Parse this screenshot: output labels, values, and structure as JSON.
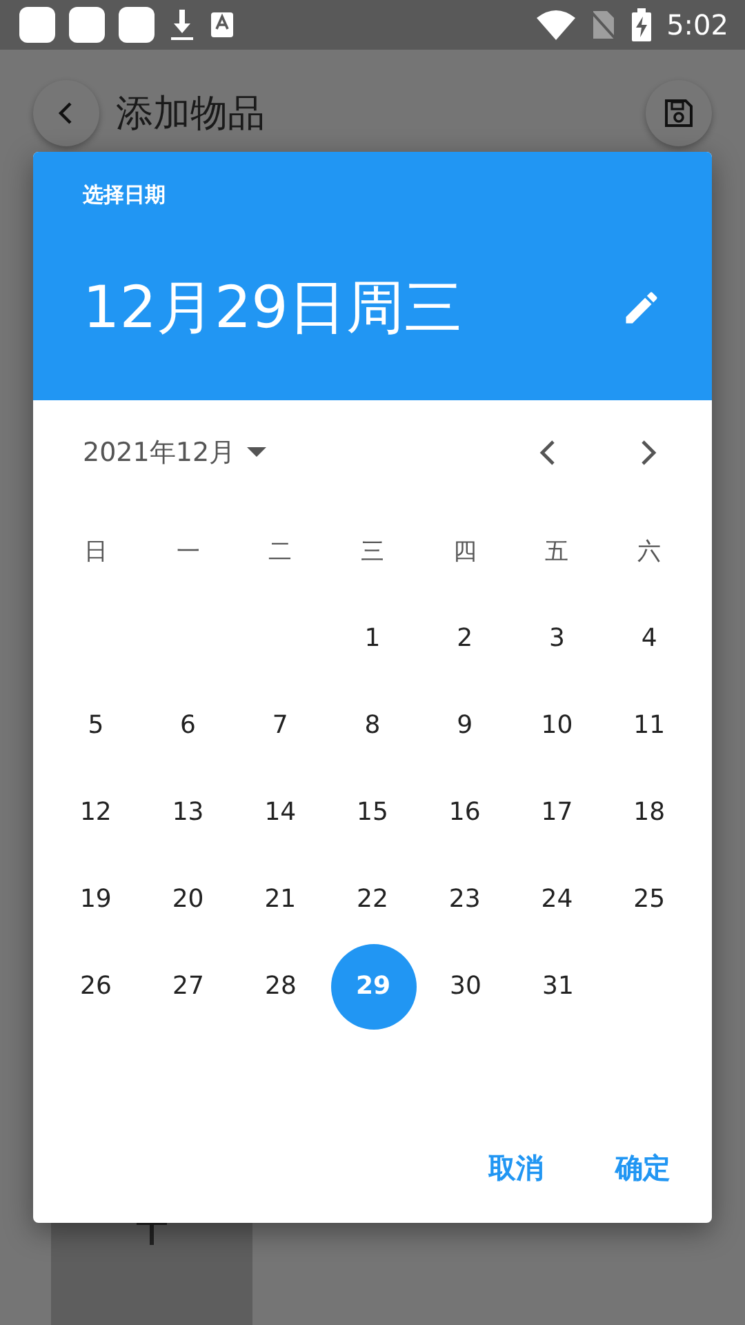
{
  "status_bar": {
    "time": "5:02"
  },
  "app_bar": {
    "title": "添加物品"
  },
  "dialog": {
    "header_label": "选择日期",
    "selected_date_text": "12月29日周三",
    "month_label": "2021年12月",
    "weekdays": [
      "日",
      "一",
      "二",
      "三",
      "四",
      "五",
      "六"
    ],
    "weeks": [
      {
        "days": [
          {
            "kind": "blank"
          },
          {
            "kind": "blank"
          },
          {
            "kind": "blank"
          },
          {
            "kind": "day",
            "label": "1",
            "selected": false
          },
          {
            "kind": "day",
            "label": "2",
            "selected": false
          },
          {
            "kind": "day",
            "label": "3",
            "selected": false
          },
          {
            "kind": "day",
            "label": "4",
            "selected": false
          }
        ]
      },
      {
        "days": [
          {
            "kind": "day",
            "label": "5",
            "selected": false
          },
          {
            "kind": "day",
            "label": "6",
            "selected": false
          },
          {
            "kind": "day",
            "label": "7",
            "selected": false
          },
          {
            "kind": "day",
            "label": "8",
            "selected": false
          },
          {
            "kind": "day",
            "label": "9",
            "selected": false
          },
          {
            "kind": "day",
            "label": "10",
            "selected": false
          },
          {
            "kind": "day",
            "label": "11",
            "selected": false
          }
        ]
      },
      {
        "days": [
          {
            "kind": "day",
            "label": "12",
            "selected": false
          },
          {
            "kind": "day",
            "label": "13",
            "selected": false
          },
          {
            "kind": "day",
            "label": "14",
            "selected": false
          },
          {
            "kind": "day",
            "label": "15",
            "selected": false
          },
          {
            "kind": "day",
            "label": "16",
            "selected": false
          },
          {
            "kind": "day",
            "label": "17",
            "selected": false
          },
          {
            "kind": "day",
            "label": "18",
            "selected": false
          }
        ]
      },
      {
        "days": [
          {
            "kind": "day",
            "label": "19",
            "selected": false
          },
          {
            "kind": "day",
            "label": "20",
            "selected": false
          },
          {
            "kind": "day",
            "label": "21",
            "selected": false
          },
          {
            "kind": "day",
            "label": "22",
            "selected": false
          },
          {
            "kind": "day",
            "label": "23",
            "selected": false
          },
          {
            "kind": "day",
            "label": "24",
            "selected": false
          },
          {
            "kind": "day",
            "label": "25",
            "selected": false
          }
        ]
      },
      {
        "days": [
          {
            "kind": "day",
            "label": "26",
            "selected": false
          },
          {
            "kind": "day",
            "label": "27",
            "selected": false
          },
          {
            "kind": "day",
            "label": "28",
            "selected": false
          },
          {
            "kind": "day",
            "label": "29",
            "selected": true
          },
          {
            "kind": "day",
            "label": "30",
            "selected": false
          },
          {
            "kind": "day",
            "label": "31",
            "selected": false
          }
        ]
      }
    ],
    "buttons": [
      "取消",
      "确定"
    ]
  }
}
